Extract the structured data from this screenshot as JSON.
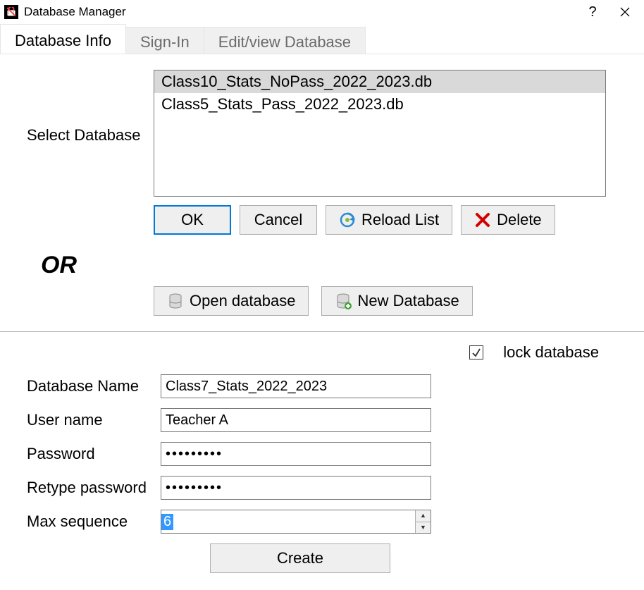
{
  "window": {
    "title": "Database Manager"
  },
  "tabs": [
    {
      "label": "Database Info",
      "active": true
    },
    {
      "label": "Sign-In",
      "active": false
    },
    {
      "label": "Edit/view Database",
      "active": false
    }
  ],
  "select_label": "Select Database",
  "db_list": [
    {
      "name": "Class10_Stats_NoPass_2022_2023.db",
      "selected": true
    },
    {
      "name": "Class5_Stats_Pass_2022_2023.db",
      "selected": false
    }
  ],
  "buttons": {
    "ok": "OK",
    "cancel": "Cancel",
    "reload": "Reload List",
    "delete": "Delete",
    "open_db": "Open database",
    "new_db": "New Database",
    "create": "Create"
  },
  "or_label": "OR",
  "lock": {
    "checked": true,
    "label": "lock database"
  },
  "form": {
    "db_name_label": "Database Name",
    "db_name_value": "Class7_Stats_2022_2023",
    "user_label": "User name",
    "user_value": "Teacher A",
    "password_label": "Password",
    "password_value": "•••••••••",
    "retype_label": "Retype password",
    "retype_value": "•••••••••",
    "maxseq_label": "Max sequence",
    "maxseq_value": "6"
  }
}
